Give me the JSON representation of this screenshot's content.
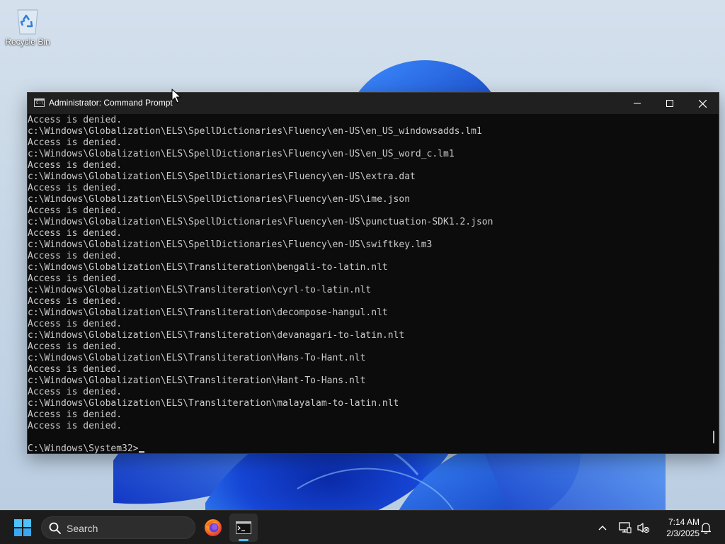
{
  "desktop": {
    "icons": [
      {
        "label": "Recycle Bin",
        "icon": "recycle-bin-icon"
      }
    ]
  },
  "window": {
    "title": "Administrator: Command Prompt",
    "icon": "command-prompt-icon",
    "controls": {
      "minimize": "minimize-icon",
      "maximize": "maximize-icon",
      "close": "close-icon"
    },
    "console": {
      "lines": [
        "Access is denied.",
        "c:\\Windows\\Globalization\\ELS\\SpellDictionaries\\Fluency\\en-US\\en_US_windowsadds.lm1",
        "Access is denied.",
        "c:\\Windows\\Globalization\\ELS\\SpellDictionaries\\Fluency\\en-US\\en_US_word_c.lm1",
        "Access is denied.",
        "c:\\Windows\\Globalization\\ELS\\SpellDictionaries\\Fluency\\en-US\\extra.dat",
        "Access is denied.",
        "c:\\Windows\\Globalization\\ELS\\SpellDictionaries\\Fluency\\en-US\\ime.json",
        "Access is denied.",
        "c:\\Windows\\Globalization\\ELS\\SpellDictionaries\\Fluency\\en-US\\punctuation-SDK1.2.json",
        "Access is denied.",
        "c:\\Windows\\Globalization\\ELS\\SpellDictionaries\\Fluency\\en-US\\swiftkey.lm3",
        "Access is denied.",
        "c:\\Windows\\Globalization\\ELS\\Transliteration\\bengali-to-latin.nlt",
        "Access is denied.",
        "c:\\Windows\\Globalization\\ELS\\Transliteration\\cyrl-to-latin.nlt",
        "Access is denied.",
        "c:\\Windows\\Globalization\\ELS\\Transliteration\\decompose-hangul.nlt",
        "Access is denied.",
        "c:\\Windows\\Globalization\\ELS\\Transliteration\\devanagari-to-latin.nlt",
        "Access is denied.",
        "c:\\Windows\\Globalization\\ELS\\Transliteration\\Hans-To-Hant.nlt",
        "Access is denied.",
        "c:\\Windows\\Globalization\\ELS\\Transliteration\\Hant-To-Hans.nlt",
        "Access is denied.",
        "c:\\Windows\\Globalization\\ELS\\Transliteration\\malayalam-to-latin.nlt",
        "Access is denied.",
        "Access is denied.",
        ""
      ],
      "prompt": "C:\\Windows\\System32>"
    }
  },
  "taskbar": {
    "start_icon": "windows-start-icon",
    "search_label": "Search",
    "pinned": [
      {
        "name": "Firefox",
        "icon": "firefox-icon"
      },
      {
        "name": "Command Prompt",
        "icon": "command-prompt-icon",
        "active": true
      }
    ],
    "tray": {
      "chevron_icon": "chevron-up-icon",
      "network_icon": "network-icon",
      "volume_icon": "volume-muted-icon",
      "time": "7:14 AM",
      "date": "2/3/2025",
      "notification_icon": "bell-icon"
    }
  },
  "colors": {
    "console_bg": "#0c0c0c",
    "console_text": "#cccccc",
    "titlebar_bg": "#202020",
    "taskbar_bg": "#1c1c1c",
    "accent": "#4cc2ff"
  }
}
